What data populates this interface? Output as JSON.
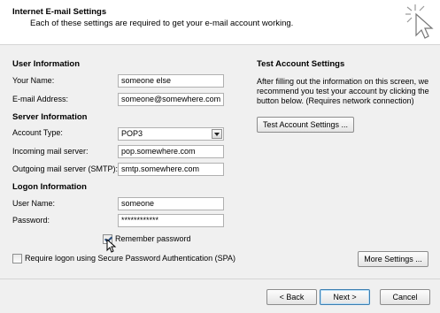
{
  "header": {
    "title": "Internet E-mail Settings",
    "subtitle": "Each of these settings are required to get your e-mail account working.",
    "icon": "sparkle-cursor-icon"
  },
  "user_info": {
    "heading": "User Information",
    "name_label": "Your Name:",
    "name_value": "someone else",
    "email_label": "E-mail Address:",
    "email_value": "someone@somewhere.com"
  },
  "server_info": {
    "heading": "Server Information",
    "account_type_label": "Account Type:",
    "account_type_value": "POP3",
    "incoming_label": "Incoming mail server:",
    "incoming_value": "pop.somewhere.com",
    "outgoing_label": "Outgoing mail server (SMTP):",
    "outgoing_value": "smtp.somewhere.com"
  },
  "logon_info": {
    "heading": "Logon Information",
    "username_label": "User Name:",
    "username_value": "someone",
    "password_label": "Password:",
    "password_value": "************",
    "remember_label": "Remember password",
    "remember_checked": true,
    "spa_label": "Require logon using Secure Password Authentication (SPA)",
    "spa_checked": false
  },
  "test_settings": {
    "heading": "Test Account Settings",
    "description": "After filling out the information on this screen, we recommend you test your account by clicking the button below. (Requires network connection)",
    "test_button": "Test Account Settings ..."
  },
  "buttons": {
    "more_settings": "More Settings ...",
    "back": "< Back",
    "next": "Next >",
    "cancel": "Cancel"
  }
}
